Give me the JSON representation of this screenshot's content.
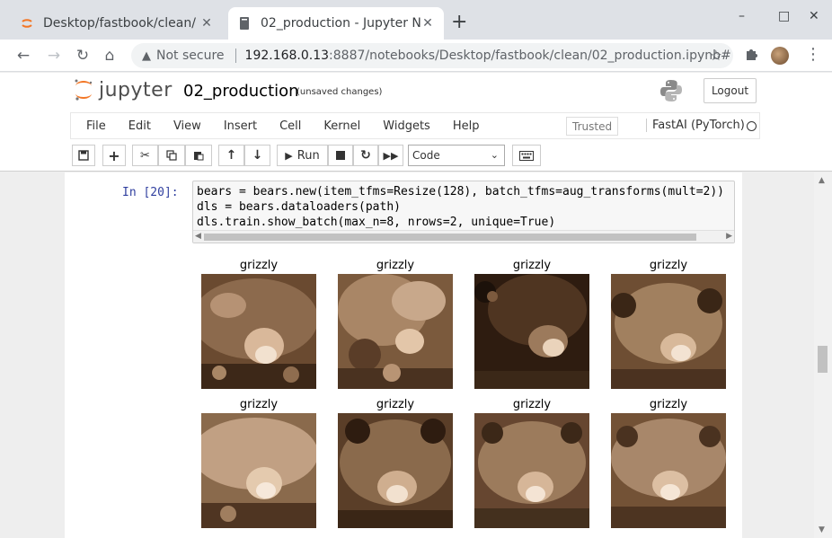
{
  "browser": {
    "tabs": [
      {
        "title": "Desktop/fastbook/clean/",
        "active": false
      },
      {
        "title": "02_production - Jupyter N",
        "active": true
      }
    ],
    "new_tab": "+",
    "window_controls": {
      "minimize": "–",
      "maximize": "□",
      "close": "✕"
    },
    "nav": {
      "back": "←",
      "forward": "→",
      "reload": "↻",
      "home": "⌂"
    },
    "security_label": "Not secure",
    "url_host": "192.168.0.13",
    "url_path": ":8887/notebooks/Desktop/fastbook/clean/02_production.ipynb#",
    "star": "☆",
    "extensions_icon": "puzzle-icon",
    "menu_dots": "⋮"
  },
  "jupyter": {
    "logo_text": "jupyter",
    "notebook_name": "02_production",
    "save_status": "(unsaved changes)",
    "logout_label": "Logout",
    "menu": [
      "File",
      "Edit",
      "View",
      "Insert",
      "Cell",
      "Kernel",
      "Widgets",
      "Help"
    ],
    "trusted_label": "Trusted",
    "kernel_name": "FastAI (PyTorch)",
    "toolbar": {
      "run_label": "Run",
      "cell_type": "Code"
    }
  },
  "cell": {
    "prompt": "In [20]:",
    "code_lines": [
      "bears = bears.new(item_tfms=Resize(128), batch_tfms=aug_transforms(mult=2))",
      "dls = bears.dataloaders(path)",
      "dls.train.show_batch(max_n=8, nrows=2, unique=True)"
    ]
  },
  "output": {
    "labels": [
      "grizzly",
      "grizzly",
      "grizzly",
      "grizzly",
      "grizzly",
      "grizzly",
      "grizzly",
      "grizzly"
    ]
  },
  "colors": {
    "tabstrip": "#dee1e6",
    "prompt_blue": "#303f9f",
    "sepia_dark": "#3a2414",
    "sepia_light": "#e7c9ae"
  }
}
